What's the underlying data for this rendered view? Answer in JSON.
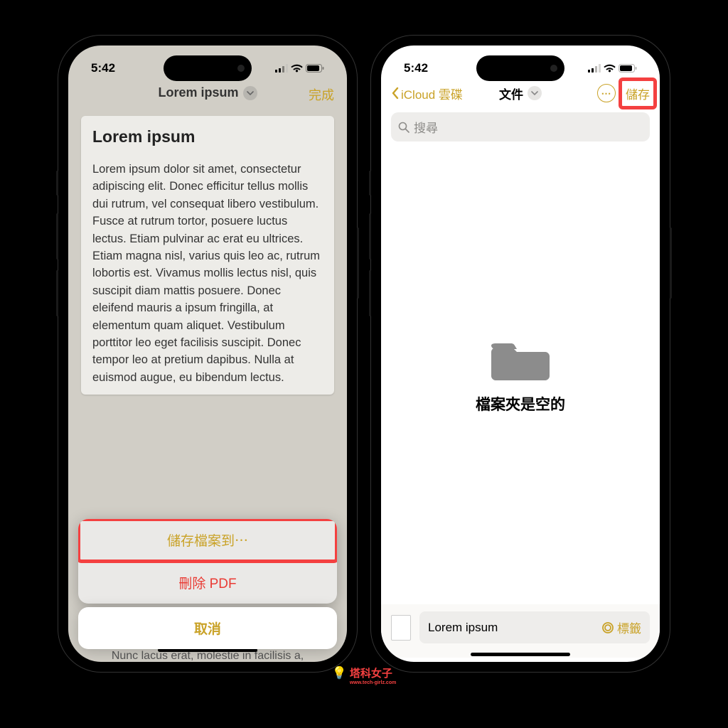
{
  "status": {
    "time": "5:42"
  },
  "left": {
    "header": {
      "title": "Lorem ipsum",
      "done": "完成"
    },
    "doc": {
      "title": "Lorem ipsum",
      "body": "Lorem ipsum dolor sit amet, consectetur adipiscing elit. Donec efficitur tellus mollis dui rutrum, vel consequat libero vestibulum. Fusce at rutrum tortor, posuere luctus lectus. Etiam pulvinar ac erat eu ultrices. Etiam magna nisl, varius quis leo ac, rutrum lobortis est. Vivamus mollis lectus nisl, quis suscipit diam mattis posuere. Donec eleifend mauris a ipsum fringilla, at elementum quam aliquet. Vestibulum porttitor leo eget facilisis suscipit. Donec tempor leo at pretium dapibus. Nulla at euismod augue, eu bibendum lectus."
    },
    "hidden_line": "Nunc lacus erat, molestie in facilisis a,",
    "sheet": {
      "save": "儲存檔案到⋯",
      "delete": "刪除 PDF",
      "cancel": "取消"
    }
  },
  "right": {
    "back": "iCloud 雲碟",
    "title": "文件",
    "save": "儲存",
    "search_placeholder": "搜尋",
    "empty": "檔案夾是空的",
    "filename": "Lorem ipsum",
    "tag_label": "標籤"
  },
  "watermark": {
    "main": "塔科女子",
    "sub": "www.tech-girlz.com"
  }
}
